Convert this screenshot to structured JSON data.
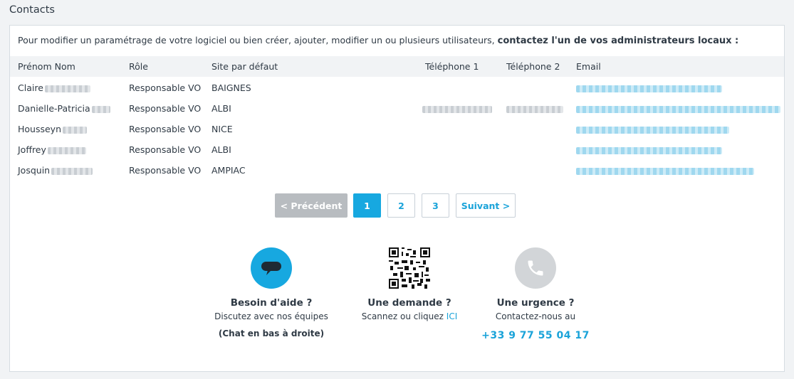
{
  "section_title": "Contacts",
  "intro": {
    "text": "Pour modifier un paramétrage de votre logiciel ou bien créer, ajouter, modifier un ou plusieurs utilisateurs,",
    "bold": "contactez l'un de vos administrateurs locaux :"
  },
  "table": {
    "headers": [
      "Prénom Nom",
      "Rôle",
      "Site par défaut",
      "Téléphone 1",
      "Téléphone 2",
      "Email"
    ],
    "rows": [
      {
        "name": "Claire",
        "role": "Responsable VO",
        "site": "BAIGNES"
      },
      {
        "name": "Danielle-Patricia",
        "role": "Responsable VO",
        "site": "ALBI"
      },
      {
        "name": "Housseyn",
        "role": "Responsable VO",
        "site": "NICE"
      },
      {
        "name": "Joffrey",
        "role": "Responsable VO",
        "site": "ALBI"
      },
      {
        "name": "Josquin",
        "role": "Responsable VO",
        "site": "AMPIAC"
      }
    ]
  },
  "pagination": {
    "prev": "< Précédent",
    "pages": [
      "1",
      "2",
      "3"
    ],
    "next": "Suivant >"
  },
  "help": {
    "chat": {
      "title": "Besoin d'aide ?",
      "subtitle": "Discutez avec nos équipes",
      "note": "(Chat en bas à droite)"
    },
    "request": {
      "title": "Une demande ?",
      "subtitle": "Scannez ou cliquez",
      "link": "ICI"
    },
    "urgent": {
      "title": "Une urgence ?",
      "subtitle": "Contactez-nous au",
      "phone": "+33 9 77 55 04 17"
    }
  },
  "colors": {
    "accent": "#17a8e0",
    "disabled": "#b8bcc0",
    "phone_circle": "#d2d5d8"
  }
}
